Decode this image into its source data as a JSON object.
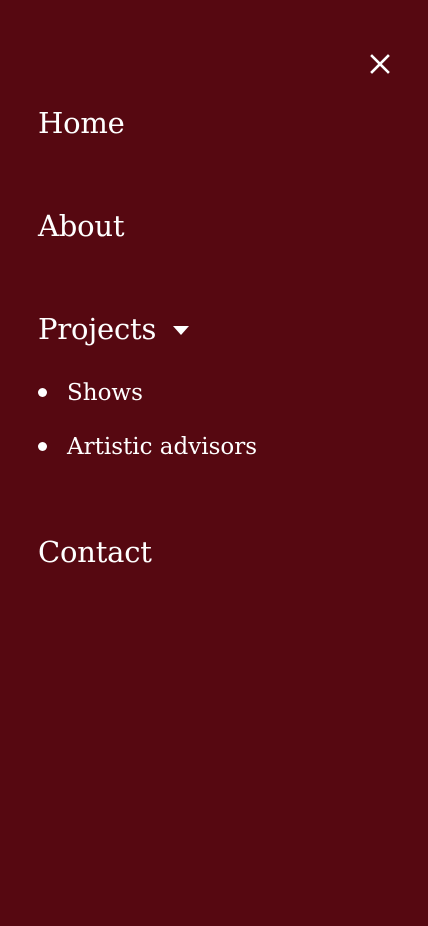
{
  "menu": {
    "close_icon": "close-icon",
    "items": [
      {
        "label": "Home"
      },
      {
        "label": "About"
      },
      {
        "label": "Projects",
        "icon": "caret-down-icon",
        "expanded": true,
        "children": [
          {
            "label": "Shows"
          },
          {
            "label": "Artistic advisors"
          }
        ]
      },
      {
        "label": "Contact"
      }
    ]
  },
  "colors": {
    "background": "#560811",
    "text": "#ffffff"
  }
}
